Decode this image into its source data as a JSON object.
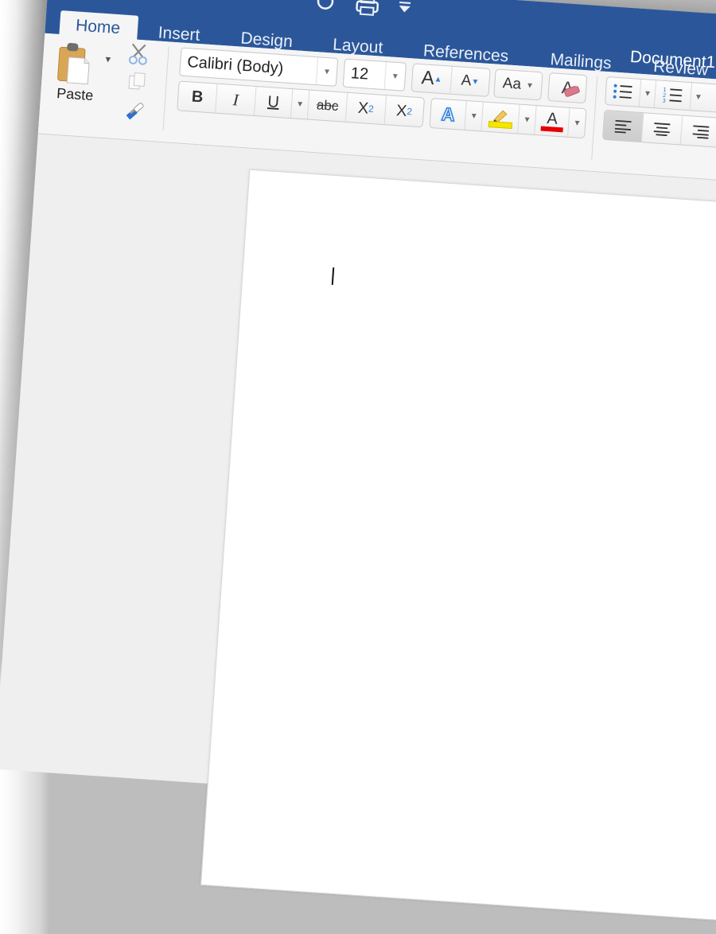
{
  "window": {
    "document_title": "Document1",
    "quick_access": [
      {
        "icon": "sidebar-icon"
      },
      {
        "icon": "save-icon"
      },
      {
        "icon": "undo-icon"
      },
      {
        "icon": "redo-icon"
      },
      {
        "icon": "print-icon"
      },
      {
        "icon": "customize-toolbar-icon"
      }
    ]
  },
  "tabs": [
    {
      "label": "Home",
      "active": true
    },
    {
      "label": "Insert"
    },
    {
      "label": "Design"
    },
    {
      "label": "Layout"
    },
    {
      "label": "References"
    },
    {
      "label": "Mailings"
    },
    {
      "label": "Review"
    }
  ],
  "ribbon": {
    "clipboard": {
      "paste_label": "Paste",
      "cut_icon": "scissors-icon",
      "copy_icon": "copy-icon",
      "format_painter_icon": "paintbrush-icon"
    },
    "font": {
      "font_name": "Calibri (Body)",
      "font_size": "12",
      "grow_label": "A",
      "shrink_label": "A",
      "change_case_label": "Aa",
      "clear_format_label": "A",
      "bold_label": "B",
      "italic_label": "I",
      "underline_label": "U",
      "strikethrough_label": "abc",
      "subscript_label": "X",
      "subscript_index": "2",
      "superscript_label": "X",
      "superscript_index": "2",
      "text_effects_label": "A",
      "font_color_label": "A",
      "highlight_color": "#f5e600",
      "font_color": "#e60000"
    },
    "paragraph": {
      "bullets_icon": "bullet-list-icon",
      "numbering_icon": "numbered-list-icon",
      "align_left_icon": "align-left-icon",
      "align_center_icon": "align-center-icon",
      "align_right_icon": "align-right-icon"
    }
  },
  "colors": {
    "brand": "#2b579a",
    "accent_blue": "#2f7fd6"
  }
}
